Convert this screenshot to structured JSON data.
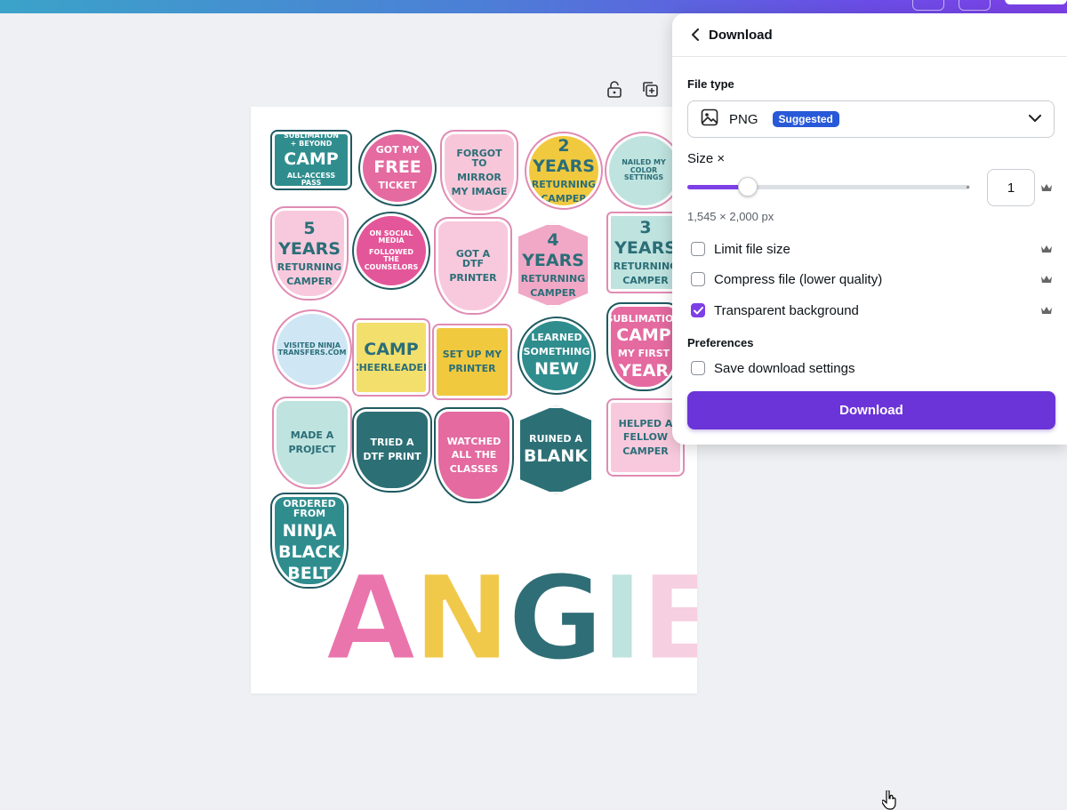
{
  "topbar": {
    "gradient_start": "#3ba3c9",
    "gradient_end": "#7d3fe6"
  },
  "canvas_toolbar": {
    "icons": [
      "unlock-icon",
      "duplicate-page-icon"
    ]
  },
  "design": {
    "stickers": [
      {
        "id": "all-access-pass",
        "lines": [
          "SUBLIMATION + BEYOND",
          "CAMP",
          "ALL-ACCESS PASS"
        ],
        "bg": "#2f8d8e"
      },
      {
        "id": "free-ticket",
        "lines": [
          "GOT MY",
          "FREE",
          "TICKET"
        ],
        "bg": "#e46aa0"
      },
      {
        "id": "forgot-mirror",
        "lines": [
          "FORGOT TO",
          "MIRROR",
          "MY IMAGE"
        ],
        "bg": "#f7c7d9"
      },
      {
        "id": "returning-2",
        "lines": [
          "2",
          "YEARS",
          "RETURNING",
          "CAMPER"
        ],
        "bg": "#f1c93e"
      },
      {
        "id": "color-settings",
        "lines": [
          "NAILED MY COLOR SETTINGS"
        ],
        "bg": "#bfe3df"
      },
      {
        "id": "returning-5",
        "lines": [
          "5",
          "YEARS",
          "RETURNING",
          "CAMPER"
        ],
        "bg": "#f8c9dc"
      },
      {
        "id": "social-media",
        "lines": [
          "ON SOCIAL MEDIA",
          "FOLLOWED THE COUNSELORS"
        ],
        "bg": "#e4569a"
      },
      {
        "id": "dtf-printer",
        "lines": [
          "GOT A DTF",
          "PRINTER"
        ],
        "bg": "#f8c9dc"
      },
      {
        "id": "returning-4",
        "lines": [
          "4",
          "YEARS",
          "RETURNING",
          "CAMPER"
        ],
        "bg": "#f1a8c6"
      },
      {
        "id": "returning-3",
        "lines": [
          "3",
          "YEARS",
          "RETURNING",
          "CAMPER"
        ],
        "bg": "#bfe3df"
      },
      {
        "id": "ninja-transfers",
        "lines": [
          "VISITED NINJA TRANSFERS.COM"
        ],
        "bg": "#cfe6f5"
      },
      {
        "id": "camp-cheerleader",
        "lines": [
          "CAMP",
          "CHEERLEADER"
        ],
        "bg": "#f3df6c"
      },
      {
        "id": "setup-printer",
        "lines": [
          "SET UP MY",
          "PRINTER"
        ],
        "bg": "#f1c93e"
      },
      {
        "id": "learned-new",
        "lines": [
          "LEARNED",
          "SOMETHING",
          "NEW"
        ],
        "bg": "#2f8d8e"
      },
      {
        "id": "first-year",
        "lines": [
          "SUBLIMATION",
          "CAMP",
          "MY FIRST",
          "YEAR"
        ],
        "bg": "#e46aa0"
      },
      {
        "id": "made-project",
        "lines": [
          "MADE A",
          "PROJECT"
        ],
        "bg": "#bfe3df"
      },
      {
        "id": "tried-dtf",
        "lines": [
          "TRIED A",
          "DTF PRINT"
        ],
        "bg": "#2c7076"
      },
      {
        "id": "watched-classes",
        "lines": [
          "WATCHED",
          "ALL THE",
          "CLASSES"
        ],
        "bg": "#e46aa0"
      },
      {
        "id": "ruined-blank",
        "lines": [
          "RUINED A",
          "BLANK"
        ],
        "bg": "#2c7076"
      },
      {
        "id": "helped-camper",
        "lines": [
          "HELPED A",
          "FELLOW",
          "CAMPER"
        ],
        "bg": "#f8c9dc"
      },
      {
        "id": "black-belt",
        "lines": [
          "ORDERED FROM",
          "NINJA",
          "BLACK",
          "BELT"
        ],
        "bg": "#2f8d8e"
      }
    ],
    "name_letters": [
      {
        "char": "A",
        "color": "#ea75ad"
      },
      {
        "char": "N",
        "color": "#f1c94a"
      },
      {
        "char": "G",
        "color": "#2f6e76"
      },
      {
        "char": "I",
        "color": "#bfe3df"
      },
      {
        "char": "E",
        "color": "#f6cfe0"
      }
    ]
  },
  "download_panel": {
    "title": "Download",
    "file_type": {
      "label": "File type",
      "value": "PNG",
      "badge": "Suggested"
    },
    "size": {
      "label": "Size ×",
      "value_fraction": 0.21,
      "input_value": "1",
      "dimensions": "1,545 × 2,000 px"
    },
    "options": [
      {
        "id": "limit",
        "label": "Limit file size",
        "checked": false
      },
      {
        "id": "compress",
        "label": "Compress file (lower quality)",
        "checked": false
      },
      {
        "id": "transparent",
        "label": "Transparent background",
        "checked": true
      }
    ],
    "preferences": {
      "label": "Preferences",
      "save_label": "Save download settings",
      "checked": false
    },
    "download_button": "Download",
    "accent": "#7d3fe6"
  }
}
